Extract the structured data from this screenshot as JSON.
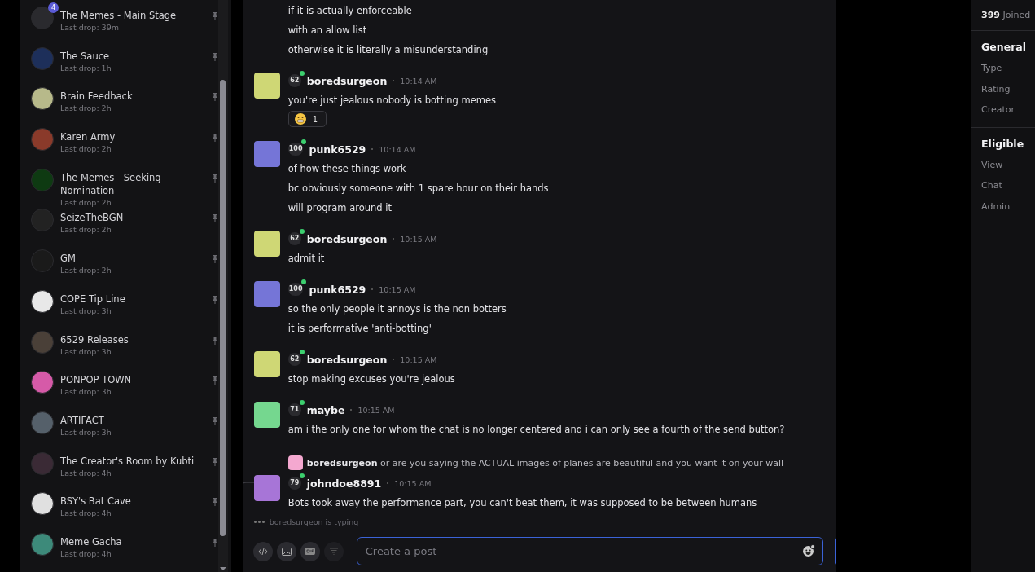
{
  "sidebar": {
    "channels": [
      {
        "name": "The Memes - Main Stage",
        "last_drop": "Last drop: 39m",
        "unread": "4"
      },
      {
        "name": "The Sauce",
        "last_drop": "Last drop: 1h"
      },
      {
        "name": "Brain Feedback",
        "last_drop": "Last drop: 2h"
      },
      {
        "name": "Karen Army",
        "last_drop": "Last drop: 2h"
      },
      {
        "name": "The Memes - Seeking Nomination",
        "last_drop": "Last drop: 2h"
      },
      {
        "name": "SeizeTheBGN",
        "last_drop": "Last drop: 2h"
      },
      {
        "name": "GM",
        "last_drop": "Last drop: 2h"
      },
      {
        "name": "COPE Tip Line",
        "last_drop": "Last drop: 3h"
      },
      {
        "name": "6529 Releases",
        "last_drop": "Last drop: 3h"
      },
      {
        "name": "PONPOP TOWN",
        "last_drop": "Last drop: 3h"
      },
      {
        "name": "ARTIFACT",
        "last_drop": "Last drop: 3h"
      },
      {
        "name": "The Creator's Room by Kubti",
        "last_drop": "Last drop: 4h"
      },
      {
        "name": "BSY's Bat Cave",
        "last_drop": "Last drop: 4h"
      },
      {
        "name": "Meme Gacha",
        "last_drop": "Last drop: 4h"
      }
    ]
  },
  "chat": {
    "messages": [
      {
        "lines": [
          "if it is actually enforceable",
          "with an allow list",
          "otherwise it is literally a misunderstanding"
        ]
      },
      {
        "author": "boredsurgeon",
        "level": "62",
        "online": true,
        "time": "10:14 AM",
        "lines": [
          "you're just jealous nobody is botting memes"
        ],
        "reaction": {
          "count": "1"
        }
      },
      {
        "author": "punk6529",
        "level": "100",
        "online": true,
        "time": "10:14 AM",
        "lines": [
          "of how these things work",
          "bc obviously someone with 1 spare hour on their hands",
          "will program around it"
        ]
      },
      {
        "author": "boredsurgeon",
        "level": "62",
        "online": true,
        "time": "10:15 AM",
        "lines": [
          "admit it"
        ]
      },
      {
        "author": "punk6529",
        "level": "100",
        "online": true,
        "time": "10:15 AM",
        "lines": [
          "so the only people it annoys is the non botters",
          "it is performative 'anti-botting'"
        ]
      },
      {
        "author": "boredsurgeon",
        "level": "62",
        "online": true,
        "time": "10:15 AM",
        "lines": [
          "stop making excuses you're jealous"
        ]
      },
      {
        "author": "maybe",
        "level": "71",
        "online": true,
        "time": "10:15 AM",
        "lines": [
          "am i the only one for whom the chat is no longer centered and i can only see a fourth of the send button?"
        ]
      },
      {
        "reply": {
          "author": "boredsurgeon",
          "text": "or are you saying the ACTUAL images of planes are beautiful and you want it on your wall"
        },
        "author": "johndoe8891",
        "level": "79",
        "online": true,
        "time": "10:15 AM",
        "lines": [
          "Bots took away the performance part, you can't beat them, it was supposed to be between humans"
        ]
      }
    ],
    "typing": "boredsurgeon is typing",
    "composer": {
      "placeholder": "Create a post"
    }
  },
  "info": {
    "joined_count": "399",
    "joined_label": "Joined",
    "sections": [
      {
        "title": "General",
        "items": [
          "Type",
          "Rating",
          "Creator"
        ]
      },
      {
        "title": "Eligible",
        "items": [
          "View",
          "Chat",
          "Admin"
        ]
      }
    ]
  }
}
